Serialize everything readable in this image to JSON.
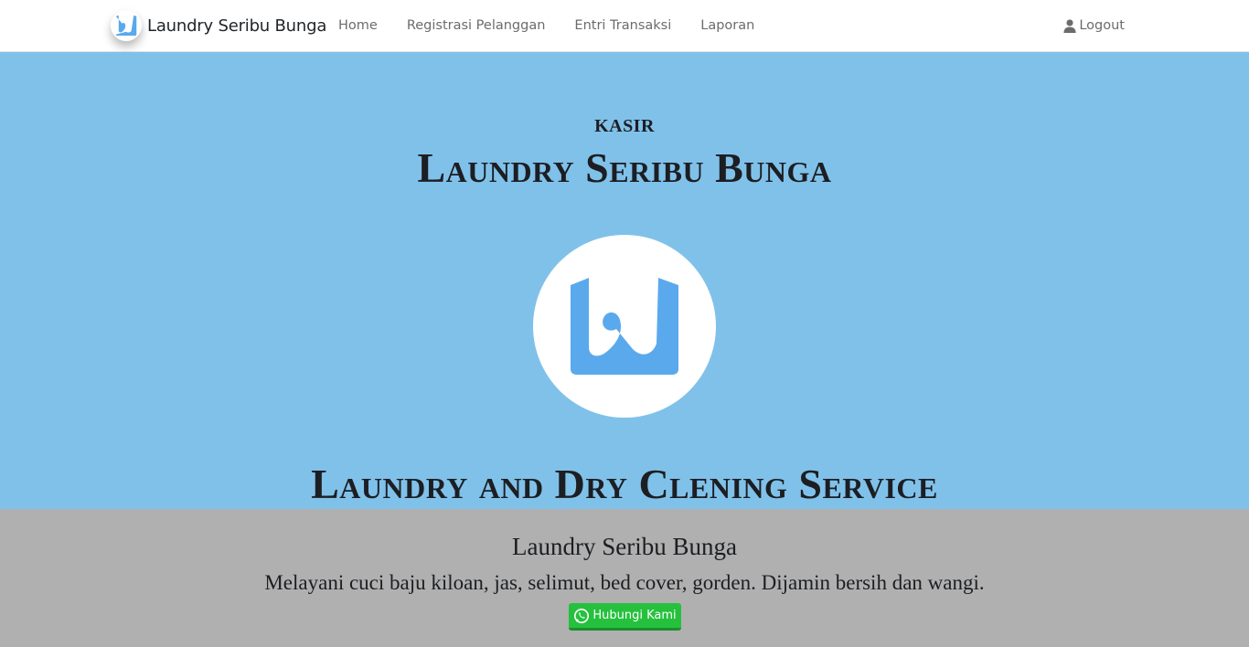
{
  "navbar": {
    "brand": "Laundry Seribu Bunga",
    "links": [
      "Home",
      "Registrasi Pelanggan",
      "Entri Transaksi",
      "Laporan"
    ],
    "logout": "Logout"
  },
  "hero": {
    "kicker": "KASIR",
    "title": "Laundry Seribu Bunga",
    "tagline": "Laundry and Dry Clening Service"
  },
  "footer": {
    "title": "Laundry Seribu Bunga",
    "description": "Melayani cuci baju kiloan, jas, selimut, bed cover, gorden. Dijamin bersih dan wangi.",
    "contact_button": "Hubungi Kami"
  },
  "icons": {
    "brand": "laundry-logo-icon",
    "logout": "user-icon",
    "contact": "whatsapp-icon"
  },
  "colors": {
    "hero_bg": "#80c1ea",
    "footer_bg": "#b0b0b0",
    "logo_blue": "#5aa9ec",
    "whatsapp_green": "#25c13d"
  }
}
